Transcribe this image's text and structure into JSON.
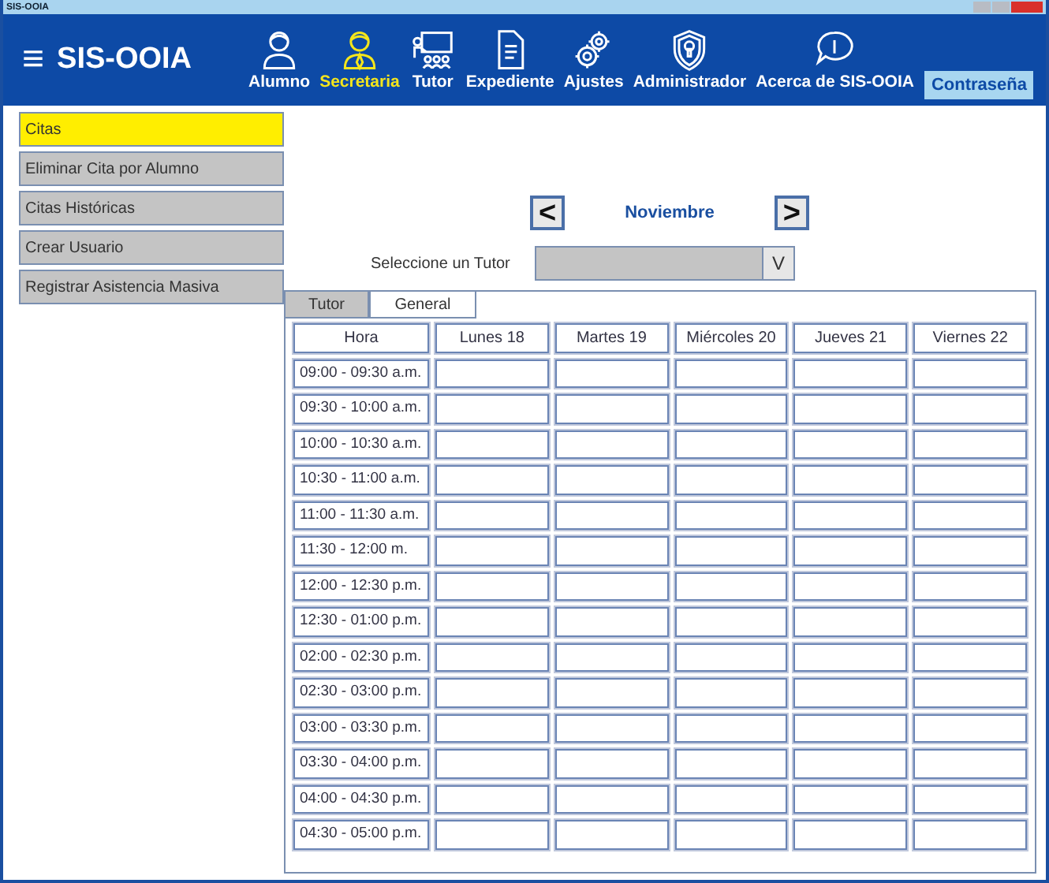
{
  "window": {
    "title": "SIS-OOIA"
  },
  "header": {
    "menu_icon": "≡",
    "app_name": "SIS-OOIA",
    "nav": [
      {
        "label": "Alumno",
        "kind": "student",
        "selected": false
      },
      {
        "label": "Secretaria",
        "kind": "secretary",
        "selected": true
      },
      {
        "label": "Tutor",
        "kind": "teacher",
        "selected": false
      },
      {
        "label": "Expediente",
        "kind": "document",
        "selected": false
      },
      {
        "label": "Ajustes",
        "kind": "gears",
        "selected": false
      },
      {
        "label": "Administrador",
        "kind": "shield",
        "selected": false
      },
      {
        "label": "Acerca de SIS-OOIA",
        "kind": "info",
        "selected": false
      }
    ],
    "password_button": "Contraseña"
  },
  "sidebar": {
    "items": [
      {
        "label": "Citas",
        "selected": true
      },
      {
        "label": "Eliminar Cita por Alumno",
        "selected": false
      },
      {
        "label": "Citas Históricas",
        "selected": false
      },
      {
        "label": "Crear Usuario",
        "selected": false
      },
      {
        "label": "Registrar Asistencia Masiva",
        "selected": false
      }
    ]
  },
  "month_nav": {
    "prev": "<",
    "month": "Noviembre",
    "next": ">"
  },
  "tutor_select": {
    "label": "Seleccione un Tutor",
    "button": "V"
  },
  "tabs": [
    {
      "label": "Tutor",
      "selected": true
    },
    {
      "label": "General",
      "selected": false
    }
  ],
  "table": {
    "columns": [
      "Hora",
      "Lunes 18",
      "Martes 19",
      "Miércoles 20",
      "Jueves 21",
      "Viernes 22"
    ],
    "rows": [
      "09:00 - 09:30 a.m.",
      "09:30 - 10:00 a.m.",
      "10:00 - 10:30 a.m.",
      "10:30 - 11:00 a.m.",
      "11:00 - 11:30 a.m.",
      "11:30 - 12:00 m.",
      "12:00 - 12:30 p.m.",
      "12:30 - 01:00 p.m.",
      "02:00 - 02:30 p.m.",
      "02:30 - 03:00 p.m.",
      "03:00 - 03:30 p.m.",
      "03:30 - 04:00 p.m.",
      "04:00 - 04:30 p.m.",
      "04:30 - 05:00 p.m."
    ]
  }
}
